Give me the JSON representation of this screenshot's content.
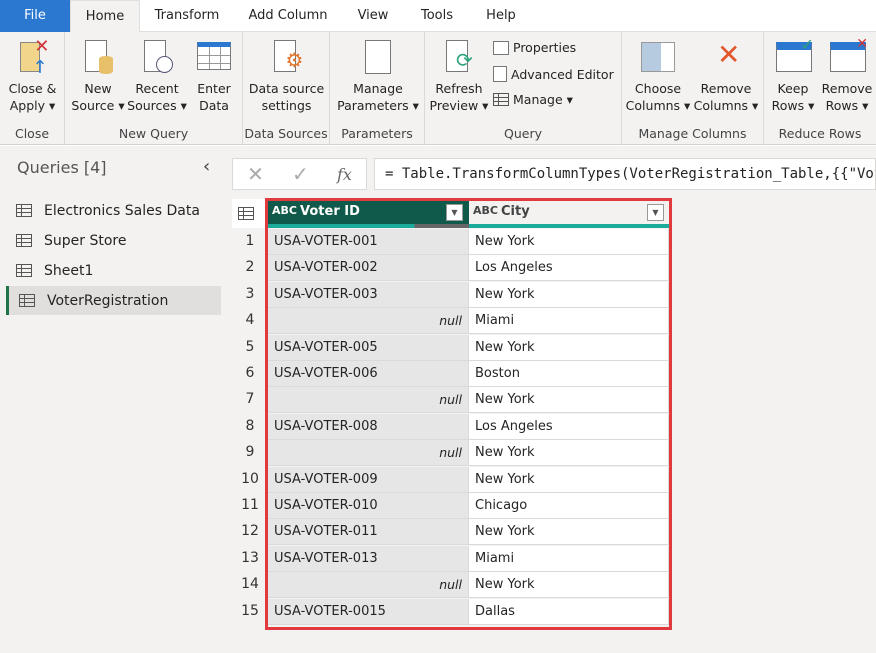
{
  "tabs": [
    "File",
    "Home",
    "Transform",
    "Add Column",
    "View",
    "Tools",
    "Help"
  ],
  "ribbon": {
    "close": {
      "btn": "Close &",
      "btn2": "Apply",
      "label": "Close"
    },
    "new_query": {
      "new1": "New",
      "new2": "Source",
      "recent1": "Recent",
      "recent2": "Sources",
      "enter1": "Enter",
      "enter2": "Data",
      "label": "New Query"
    },
    "data_sources": {
      "b1": "Data source",
      "b2": "settings",
      "label": "Data Sources"
    },
    "parameters": {
      "b1": "Manage",
      "b2": "Parameters",
      "label": "Parameters"
    },
    "query": {
      "r1": "Refresh",
      "r2": "Preview",
      "properties": "Properties",
      "advanced": "Advanced Editor",
      "manage": "Manage",
      "label": "Query"
    },
    "manage_columns": {
      "c1": "Choose",
      "c2": "Columns",
      "rm1": "Remove",
      "rm2": "Columns",
      "label": "Manage Columns"
    },
    "reduce_rows": {
      "k1": "Keep",
      "k2": "Rows",
      "r1": "Remove",
      "r2": "Rows",
      "label": "Reduce Rows"
    }
  },
  "queries": {
    "title": "Queries [4]",
    "items": [
      "Electronics Sales Data",
      "Super Store",
      "Sheet1",
      "VoterRegistration"
    ],
    "selected": "VoterRegistration"
  },
  "formula": "= Table.TransformColumnTypes(VoterRegistration_Table,{{\"Voter",
  "table": {
    "columns": [
      {
        "type": "ABC",
        "name": "Voter ID"
      },
      {
        "type": "ABC",
        "name": "City"
      }
    ],
    "rows": [
      [
        "1",
        "USA-VOTER-001",
        "New York"
      ],
      [
        "2",
        "USA-VOTER-002",
        "Los Angeles"
      ],
      [
        "3",
        "USA-VOTER-003",
        "New York"
      ],
      [
        "4",
        "null",
        "Miami"
      ],
      [
        "5",
        "USA-VOTER-005",
        "New York"
      ],
      [
        "6",
        "USA-VOTER-006",
        "Boston"
      ],
      [
        "7",
        "null",
        "New York"
      ],
      [
        "8",
        "USA-VOTER-008",
        "Los Angeles"
      ],
      [
        "9",
        "null",
        "New York"
      ],
      [
        "10",
        "USA-VOTER-009",
        "New York"
      ],
      [
        "11",
        "USA-VOTER-010",
        "Chicago"
      ],
      [
        "12",
        "USA-VOTER-011",
        "New York"
      ],
      [
        "13",
        "USA-VOTER-013",
        "Miami"
      ],
      [
        "14",
        "null",
        "New York"
      ],
      [
        "15",
        "USA-VOTER-0015",
        "Dallas"
      ]
    ]
  },
  "colors": {
    "file_tab": "#2b78d0",
    "selected_header": "#0f5a4a",
    "quality_bar": "#1aab9b",
    "highlight": "#e03a3e"
  }
}
